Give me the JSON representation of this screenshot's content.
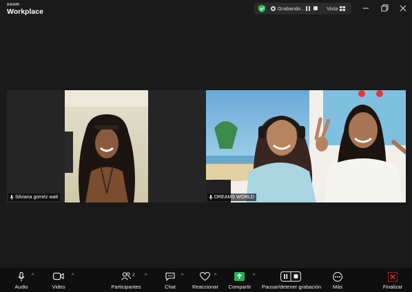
{
  "app": {
    "brand_small": "zoom",
    "brand_big": "Workplace"
  },
  "recording": {
    "status": "Grabando...",
    "view_label": "Vista"
  },
  "tiles": [
    {
      "name": "Silviana gomez watt"
    },
    {
      "name": "DREAMS WORLD"
    }
  ],
  "toolbar": {
    "audio": "Audio",
    "video": "Video",
    "participants": "Participantes",
    "participants_count": "2",
    "chat": "Chat",
    "react": "Reaccionar",
    "share": "Compartir",
    "pause_stop": "Pausar/detener grabación",
    "more": "Más",
    "end": "Finalizar"
  },
  "colors": {
    "share_green": "#23b14d",
    "end_red": "#e02828",
    "shield_green": "#22c55e"
  }
}
